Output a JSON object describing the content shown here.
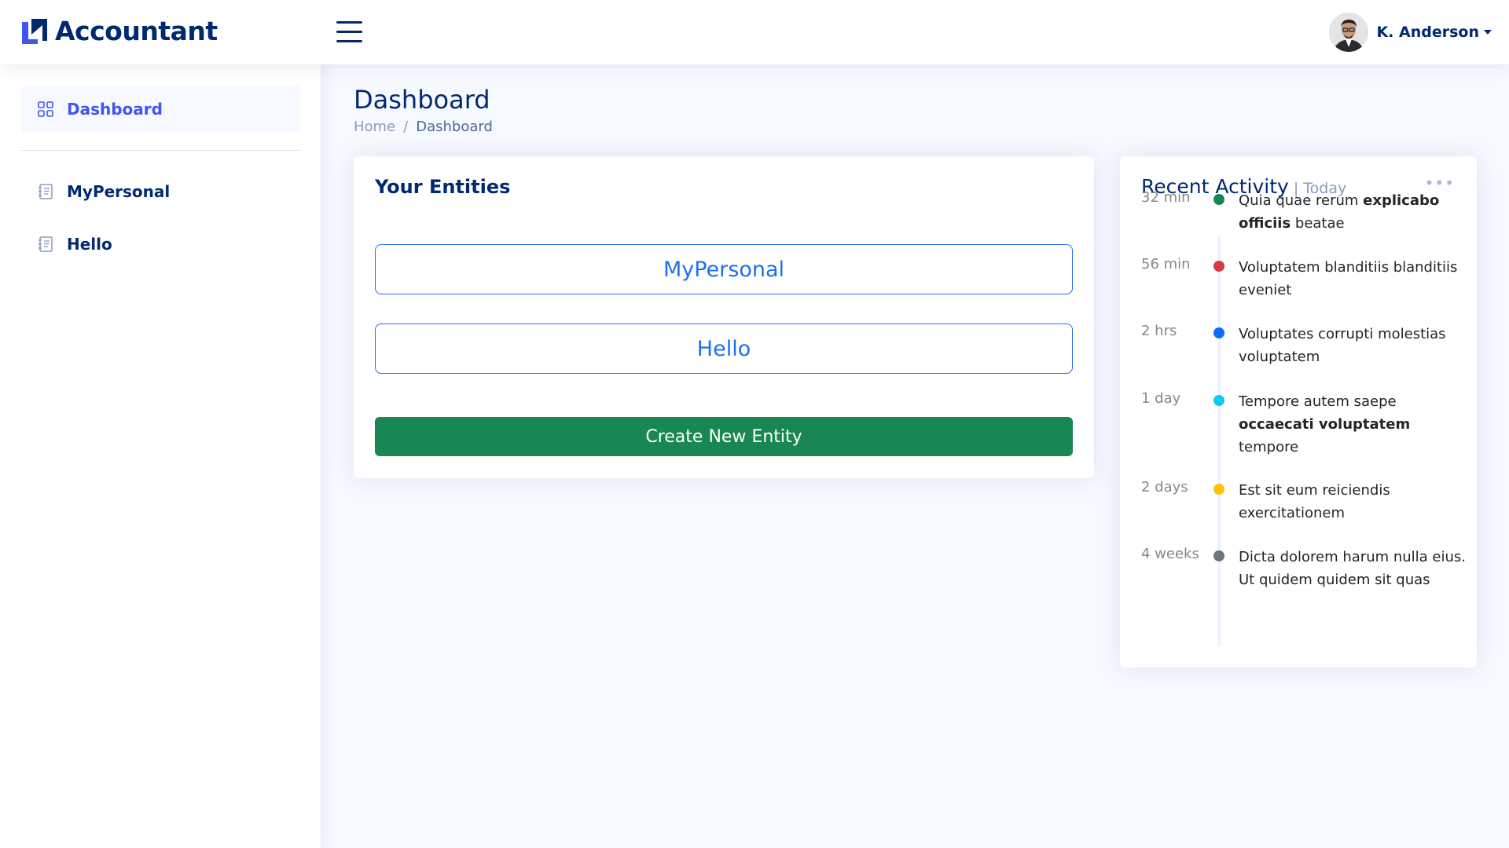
{
  "header": {
    "app_name": "Accountant",
    "user_name": "K. Anderson"
  },
  "sidebar": {
    "items": [
      {
        "label": "Dashboard",
        "icon": "grid-icon",
        "active": true
      },
      {
        "label": "MyPersonal",
        "icon": "journal-text-icon",
        "active": false
      },
      {
        "label": "Hello",
        "icon": "journal-text-icon",
        "active": false
      }
    ]
  },
  "page": {
    "title": "Dashboard",
    "breadcrumb": [
      "Home",
      "Dashboard"
    ],
    "breadcrumb_separator": "/"
  },
  "entities": {
    "title": "Your Entities",
    "items": [
      "MyPersonal",
      "Hello"
    ],
    "create_label": "Create New Entity"
  },
  "activity": {
    "title": "Recent Activity",
    "subtitle": "| Today",
    "items": [
      {
        "time": "32 min",
        "color": "#198754",
        "parts": [
          [
            "Quia quae rerum ",
            false
          ],
          [
            "explicabo officiis",
            true
          ],
          [
            " beatae",
            false
          ]
        ]
      },
      {
        "time": "56 min",
        "color": "#dc3545",
        "parts": [
          [
            "Voluptatem blanditiis blanditiis eveniet",
            false
          ]
        ]
      },
      {
        "time": "2 hrs",
        "color": "#0d6efd",
        "parts": [
          [
            "Voluptates corrupti molestias voluptatem",
            false
          ]
        ]
      },
      {
        "time": "1 day",
        "color": "#0dcaf0",
        "parts": [
          [
            "Tempore autem saepe ",
            false
          ],
          [
            "occaecati voluptatem",
            true
          ],
          [
            " tempore",
            false
          ]
        ]
      },
      {
        "time": "2 days",
        "color": "#ffc107",
        "parts": [
          [
            "Est sit eum reiciendis exercitationem",
            false
          ]
        ]
      },
      {
        "time": "4 weeks",
        "color": "#6c757d",
        "parts": [
          [
            "Dicta dolorem harum nulla eius. Ut quidem quidem sit quas",
            false
          ]
        ]
      }
    ]
  },
  "colors": {
    "primary": "#012970",
    "accent": "#4154f1",
    "entity_blue": "#1e6ff1",
    "create_green": "#198754"
  }
}
